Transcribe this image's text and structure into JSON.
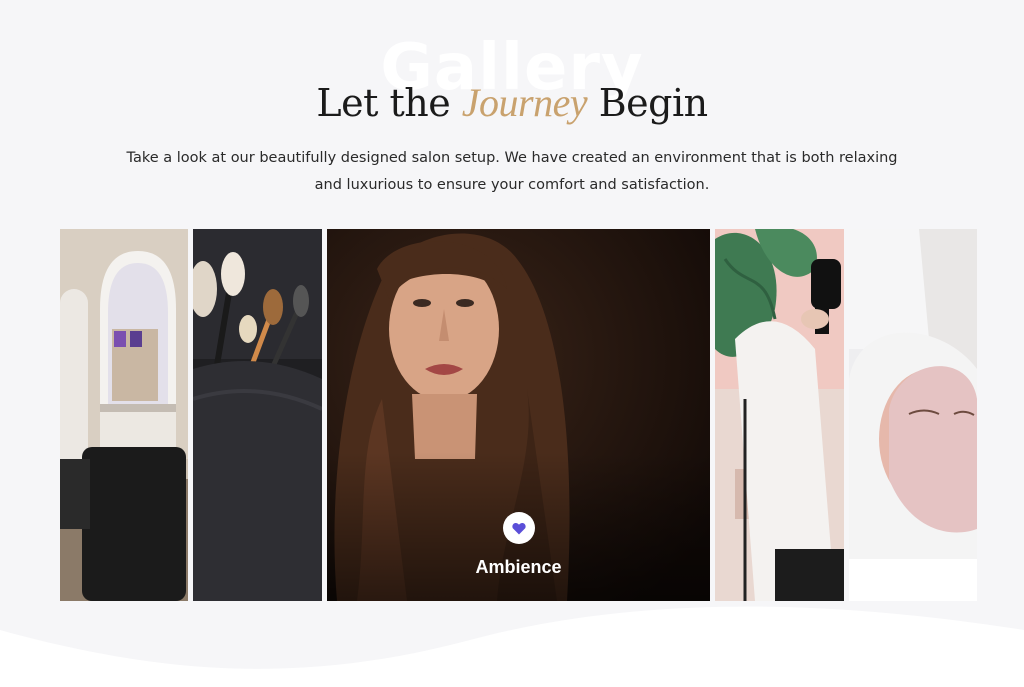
{
  "section": {
    "watermark": "Gallery",
    "title_part1": "Let the ",
    "title_accent": "Journey",
    "title_part2": " Begin",
    "description": "Take a look at our beautifully designed salon setup. We have created an environment that is both relaxing and luxurious to ensure your comfort and satisfaction."
  },
  "gallery": {
    "active_caption": "Ambience",
    "active_icon": "heart-icon",
    "panels": [
      {
        "name": "salon-interior",
        "active": false
      },
      {
        "name": "makeup-brushes",
        "active": false
      },
      {
        "name": "woman-portrait",
        "active": true
      },
      {
        "name": "hair-dryer-styling",
        "active": false
      },
      {
        "name": "facial-mask",
        "active": false
      }
    ]
  },
  "colors": {
    "accent_gold": "#c9a26e",
    "heart_purple": "#5b4fd8",
    "background": "#f6f6f8"
  }
}
